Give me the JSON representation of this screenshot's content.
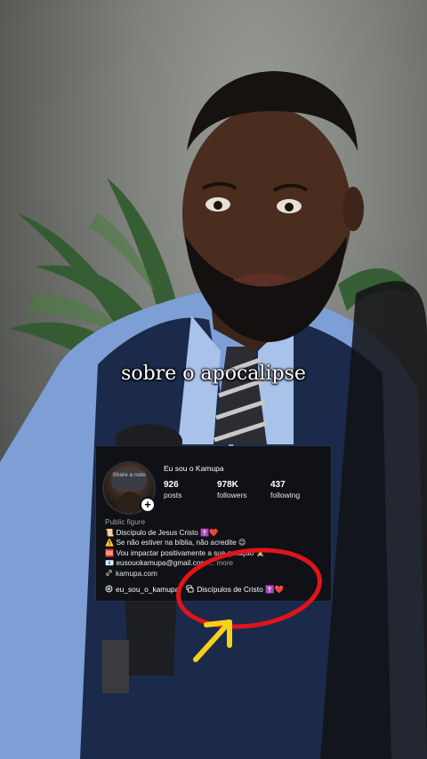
{
  "video": {
    "caption": "sobre o apocalipse"
  },
  "profile": {
    "note": "Share a note",
    "username": "Eu sou o Kamupa",
    "stats": [
      {
        "value": "926",
        "label": "posts"
      },
      {
        "value": "978K",
        "label": "followers"
      },
      {
        "value": "437",
        "label": "following"
      }
    ],
    "category": "Public figure",
    "bio_lines": [
      "📜 Discípulo de Jesus Cristo ✝️❤️",
      "⚠️ Se não estiver na bíblia, não acredite 😉",
      "🆘 Vou impactar positivamente a sua geração 🙏",
      "📧 eusouokamupa@gmail.com"
    ],
    "more_label": "... more",
    "website": "kamupa.com",
    "threads_handle": "eu_sou_o_kamupa",
    "channel_name": "Discípulos de Cristo ✝️❤️"
  },
  "annotation": {
    "circle_color": "#e0141b",
    "arrow_color": "#f4d21a"
  }
}
